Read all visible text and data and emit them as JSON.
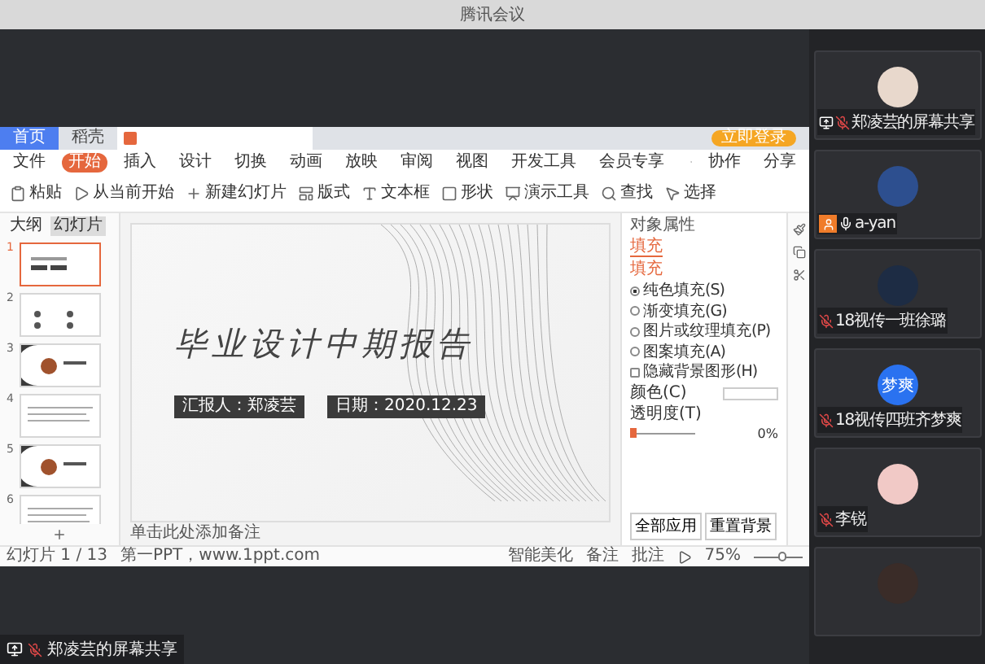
{
  "window": {
    "title": "腾讯会议"
  },
  "wps": {
    "app_tabs": [
      {
        "label": "首页",
        "selected": false
      },
      {
        "label": "稻壳",
        "selected": false
      }
    ],
    "login_button": "立即登录",
    "menu": [
      {
        "label": "文件",
        "selected": false
      },
      {
        "label": "开始",
        "selected": true
      },
      {
        "label": "插入",
        "selected": false
      },
      {
        "label": "设计",
        "selected": false
      },
      {
        "label": "切换",
        "selected": false
      },
      {
        "label": "动画",
        "selected": false
      },
      {
        "label": "放映",
        "selected": false
      },
      {
        "label": "审阅",
        "selected": false
      },
      {
        "label": "视图",
        "selected": false
      },
      {
        "label": "开发工具",
        "selected": false
      },
      {
        "label": "会员专享",
        "selected": false
      }
    ],
    "menu_actions": [
      "协作",
      "分享"
    ],
    "ribbon": [
      "粘贴",
      "从当前开始",
      "新建幻灯片",
      "版式",
      "文本框",
      "形状",
      "演示工具",
      "查找",
      "选择"
    ],
    "panel_tabs": [
      {
        "label": "大纲",
        "selected": false
      },
      {
        "label": "幻灯片",
        "selected": true
      }
    ],
    "thumbnails": [
      {
        "number": "1",
        "selected": true,
        "kind": "title"
      },
      {
        "number": "2",
        "selected": false,
        "kind": "contents"
      },
      {
        "number": "3",
        "selected": false,
        "kind": "part"
      },
      {
        "number": "4",
        "selected": false,
        "kind": "text"
      },
      {
        "number": "5",
        "selected": false,
        "kind": "part"
      },
      {
        "number": "6",
        "selected": false,
        "kind": "text"
      }
    ],
    "slide": {
      "title": "毕业设计中期报告",
      "reporter": "汇报人：郑凌芸",
      "date": "日期：2020.12.23"
    },
    "notes_placeholder": "单击此处添加备注",
    "pane": {
      "title": "对象属性",
      "tab": {
        "label": "填充",
        "selected": true
      },
      "section": "填充",
      "options": [
        {
          "label": "纯色填充(S)",
          "kind": "radio",
          "checked": true
        },
        {
          "label": "渐变填充(G)",
          "kind": "radio",
          "checked": false
        },
        {
          "label": "图片或纹理填充(P)",
          "kind": "radio",
          "checked": false
        },
        {
          "label": "图案填充(A)",
          "kind": "radio",
          "checked": false
        },
        {
          "label": "隐藏背景图形(H)",
          "kind": "checkbox",
          "checked": false
        }
      ],
      "color_label": "颜色(C)",
      "transparency_label": "透明度(T)",
      "transparency": {
        "level": 0,
        "reading": "0%"
      },
      "buttons": [
        "全部应用",
        "重置背景"
      ]
    },
    "status_bar": {
      "slide_count": "幻灯片 1 / 13",
      "theme": "第一PPT，www.1ppt.com",
      "beautify": "智能美化",
      "notes": "备注",
      "comments": "批注",
      "zoom": "75%",
      "zoom_slider": {
        "level": 0.6
      }
    }
  },
  "participants": [
    {
      "name": "郑凌芸的屏幕共享",
      "muted": true,
      "sharing": true,
      "host": false,
      "avatar": {
        "kind": "photo",
        "color": "#e8d8cc"
      }
    },
    {
      "name": "a-yan",
      "muted": false,
      "sharing": false,
      "host": true,
      "avatar": {
        "kind": "photo",
        "color": "#2d4f8f"
      }
    },
    {
      "name": "18视传一班徐璐",
      "muted": true,
      "sharing": false,
      "host": false,
      "avatar": {
        "kind": "photo",
        "color": "#1d2c44"
      }
    },
    {
      "name": "18视传四班齐梦爽",
      "muted": true,
      "sharing": false,
      "host": false,
      "avatar": {
        "kind": "initials",
        "text": "梦爽",
        "color": "#2a72f0"
      }
    },
    {
      "name": "李锐",
      "muted": true,
      "sharing": false,
      "host": false,
      "avatar": {
        "kind": "photo",
        "color": "#f1c9c6"
      }
    },
    {
      "avatar": {
        "kind": "photo",
        "color": "#3a2c28"
      }
    }
  ],
  "share_label": {
    "name": "郑凌芸的屏幕共享",
    "muted": true,
    "sharing": true
  }
}
